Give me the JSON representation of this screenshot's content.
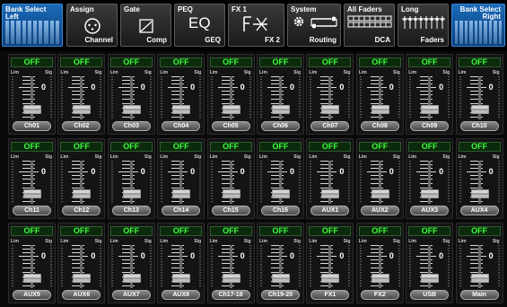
{
  "topbar": {
    "bank_left": {
      "line1": "Bank Select",
      "line2": "Left"
    },
    "assign": {
      "title": "Assign",
      "sub": "Channel",
      "icon": "assign-dial-icon"
    },
    "gate": {
      "title": "Gate",
      "sub": "Comp",
      "icon": "gate-curve-icon"
    },
    "peq": {
      "title": "PEQ",
      "center": "EQ",
      "sub": "GEQ"
    },
    "fx": {
      "title": "FX 1",
      "sub": "FX 2",
      "icon": "fx-icon"
    },
    "system": {
      "title": "System",
      "sub": "Routing",
      "icon": "gear-icon"
    },
    "all_faders": {
      "title": "All Faders",
      "sub": "DCA",
      "icon": "fader-grid-icon"
    },
    "long": {
      "title": "Long",
      "sub": "Faders",
      "icon": "long-faders-icon"
    },
    "bank_right": {
      "line1": "Bank Select",
      "line2": "Right"
    }
  },
  "strip_common": {
    "mute_label": "OFF",
    "lim_label": "Lim",
    "sig_label": "Sig",
    "zero_label": "0"
  },
  "rows": [
    {
      "channels": [
        {
          "name": "Ch01",
          "level": 0.2
        },
        {
          "name": "Ch02",
          "level": 0.2
        },
        {
          "name": "Ch03",
          "level": 0.2
        },
        {
          "name": "Ch04",
          "level": 0.2
        },
        {
          "name": "Ch05",
          "level": 0.2
        },
        {
          "name": "Ch06",
          "level": 0.2
        },
        {
          "name": "Ch07",
          "level": 0.2
        },
        {
          "name": "Ch08",
          "level": 0.2
        },
        {
          "name": "Ch09",
          "level": 0.2
        },
        {
          "name": "Ch10",
          "level": 0.2
        }
      ]
    },
    {
      "channels": [
        {
          "name": "Ch11",
          "level": 0.2
        },
        {
          "name": "Ch12",
          "level": 0.2
        },
        {
          "name": "Ch13",
          "level": 0.2
        },
        {
          "name": "Ch14",
          "level": 0.2
        },
        {
          "name": "Ch15",
          "level": 0.2
        },
        {
          "name": "Ch16",
          "level": 0.2
        },
        {
          "name": "AUX1",
          "level": 0.2
        },
        {
          "name": "AUX2",
          "level": 0.2
        },
        {
          "name": "AUX3",
          "level": 0.2
        },
        {
          "name": "AUX4",
          "level": 0.2
        }
      ]
    },
    {
      "channels": [
        {
          "name": "AUX5",
          "level": 0.2
        },
        {
          "name": "AUX6",
          "level": 0.2
        },
        {
          "name": "AUX7",
          "level": 0.2
        },
        {
          "name": "AUX8",
          "level": 0.2
        },
        {
          "name": "Ch17-18",
          "level": 0.2
        },
        {
          "name": "Ch19-20",
          "level": 0.2
        },
        {
          "name": "FX1",
          "level": 0.2
        },
        {
          "name": "FX2",
          "level": 0.2
        },
        {
          "name": "USB",
          "level": 0.2
        },
        {
          "name": "Main",
          "level": 0.2
        }
      ]
    }
  ],
  "colors": {
    "mute_off_text": "#3cff3c",
    "bank_button": "#1a6ab8",
    "strip_bg": "#141414"
  }
}
